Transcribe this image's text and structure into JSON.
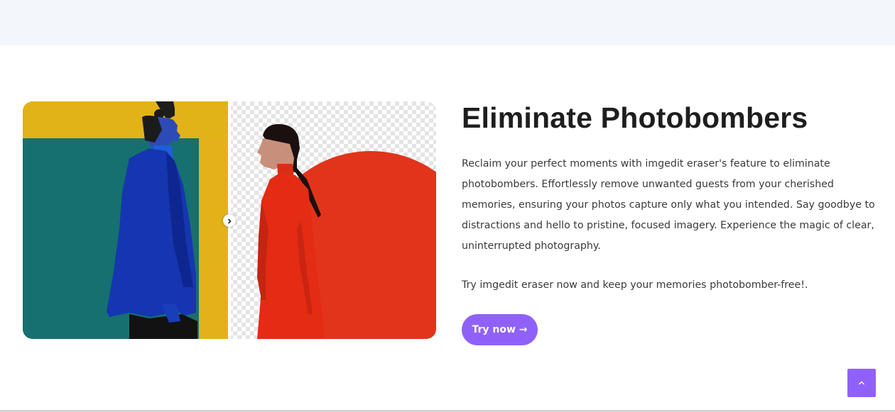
{
  "feature": {
    "title": "Eliminate Photobombers",
    "description": "Reclaim your perfect moments with imgedit eraser's feature to eliminate photobombers. Effortlessly remove unwanted guests from your cherished memories, ensuring your photos capture only what you intended. Say goodbye to distractions and hello to pristine, focused imagery. Experience the magic of clear, uninterrupted photography.",
    "cta_text": "Try imgedit eraser now and keep your memories photobomber-free!.",
    "button_label": "Try now →"
  },
  "icons": {
    "slider_handle": "chevron-right-icon",
    "scroll_top": "chevron-up-icon"
  },
  "colors": {
    "accent": "#9061f9",
    "top_band": "#f3f6fa"
  }
}
